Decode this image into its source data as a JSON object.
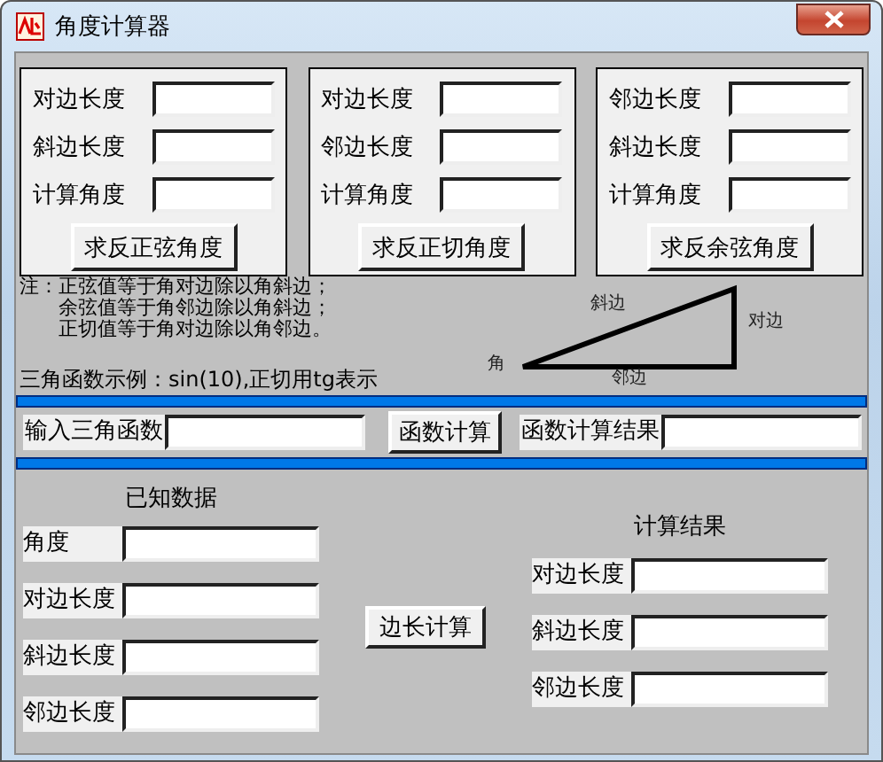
{
  "window": {
    "title": "角度计算器"
  },
  "panels": [
    {
      "fields": [
        {
          "label": "对边长度"
        },
        {
          "label": "斜边长度"
        },
        {
          "label": "计算角度"
        }
      ],
      "button": "求反正弦角度"
    },
    {
      "fields": [
        {
          "label": "对边长度"
        },
        {
          "label": "邻边长度"
        },
        {
          "label": "计算角度"
        }
      ],
      "button": "求反正切角度"
    },
    {
      "fields": [
        {
          "label": "邻边长度"
        },
        {
          "label": "斜边长度"
        },
        {
          "label": "计算角度"
        }
      ],
      "button": "求反余弦角度"
    }
  ],
  "note": {
    "prefix": "注：",
    "lines": [
      "正弦值等于角对边除以角斜边；",
      "余弦值等于角邻边除以角斜边；",
      "正切值等于角对边除以角邻边。"
    ]
  },
  "example": "三角函数示例：sin(10),正切用tg表示",
  "diagram": {
    "hypotenuse": "斜边",
    "opposite": "对边",
    "adjacent": "邻边",
    "angle": "角"
  },
  "function_row": {
    "input_label": "输入三角函数",
    "button": "函数计算",
    "result_label": "函数计算结果"
  },
  "known": {
    "title": "已知数据",
    "fields": [
      {
        "label": "角度"
      },
      {
        "label": "对边长度"
      },
      {
        "label": "斜边长度"
      },
      {
        "label": "邻边长度"
      }
    ]
  },
  "calc_button": "边长计算",
  "results": {
    "title": "计算结果",
    "fields": [
      {
        "label": "对边长度"
      },
      {
        "label": "斜边长度"
      },
      {
        "label": "邻边长度"
      }
    ]
  }
}
